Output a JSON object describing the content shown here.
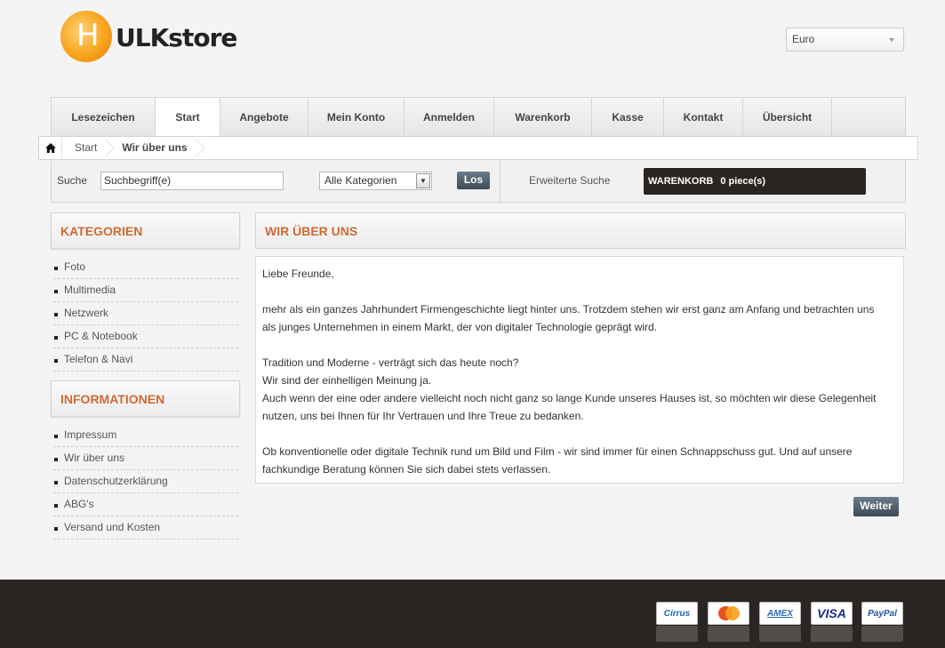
{
  "brand": {
    "logo_letter": "H",
    "logo_rest": "ULKstore"
  },
  "currency": {
    "selected": "Euro"
  },
  "nav": [
    {
      "label": "Lesezeichen"
    },
    {
      "label": "Start"
    },
    {
      "label": "Angebote"
    },
    {
      "label": "Mein Konto"
    },
    {
      "label": "Anmelden"
    },
    {
      "label": "Warenkorb"
    },
    {
      "label": "Kasse"
    },
    {
      "label": "Kontakt"
    },
    {
      "label": "Übersicht"
    }
  ],
  "breadcrumb": {
    "home_icon": "home-icon",
    "items": [
      "Start",
      "Wir über uns"
    ]
  },
  "search": {
    "label": "Suche",
    "value": "Suchbegriff(e)",
    "category": "Alle Kategorien",
    "go": "Los",
    "advanced": "Erweiterte Suche"
  },
  "cart": {
    "label": "WARENKORB",
    "count": "0 piece(s)"
  },
  "categories": {
    "title": "KATEGORIEN",
    "items": [
      "Foto",
      "Multimedia",
      "Netzwerk",
      "PC & Notebook",
      "Telefon & Navi"
    ]
  },
  "information": {
    "title": "INFORMATIONEN",
    "items": [
      "Impressum",
      "Wir über uns",
      "Datenschutzerklärung",
      "ABG's",
      "Versand und Kosten"
    ]
  },
  "main": {
    "title": "WIR ÜBER UNS",
    "p1": "Liebe Freunde,",
    "p2a": "mehr als ein ganzes Jahrhundert Firmengeschichte liegt hinter uns. Trotzdem stehen wir erst ganz am Anfang und betrachten uns",
    "p2b": "als junges Unternehmen in einem Markt, der von digitaler Technologie geprägt wird.",
    "p3a": "Tradition und Moderne - verträgt sich das heute noch?",
    "p3b": "Wir sind der einhelligen Meinung ja.",
    "p3c": "Auch wenn der eine oder andere vielleicht noch nicht ganz so lange Kunde unseres Hauses ist, so möchten wir diese Gelegenheit",
    "p3d": "nutzen, uns bei Ihnen für Ihr Vertrauen und Ihre Treue zu bedanken.",
    "p4a": "Ob konventionelle oder digitale Technik rund um Bild und Film - wir sind immer für einen Schnappschuss gut. Und auf unsere",
    "p4b": "fachkundige Beratung können Sie sich dabei stets verlassen.",
    "continue": "Weiter"
  },
  "payments": [
    {
      "label": "Cirrus",
      "color": "#1f63b4"
    },
    {
      "label": "MasterCard",
      "color": "#e8541e"
    },
    {
      "label": "AMEX",
      "color": "#2b6db5"
    },
    {
      "label": "VISA",
      "color": "#1a2a8c"
    },
    {
      "label": "PayPal",
      "color": "#1e4f9e"
    }
  ]
}
